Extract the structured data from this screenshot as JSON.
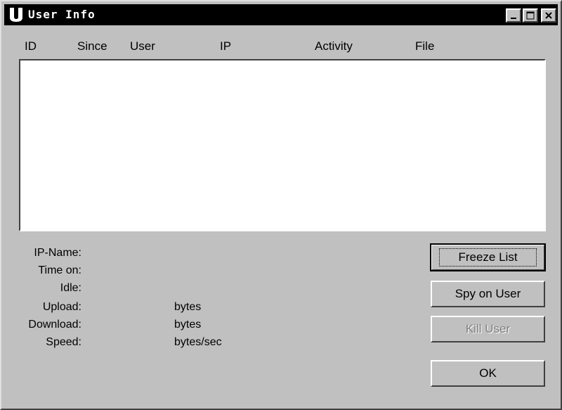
{
  "window": {
    "title": "User Info"
  },
  "columns": [
    "ID",
    "Since",
    "User",
    "IP",
    "Activity",
    "File"
  ],
  "info_labels": [
    "IP-Name:",
    "Time on:",
    "Idle:",
    "Upload:",
    "Download:",
    "Speed:"
  ],
  "units": {
    "upload": "bytes",
    "download": "bytes",
    "speed": "bytes/sec"
  },
  "buttons": {
    "freeze": "Freeze List",
    "spy": "Spy on User",
    "kill": "Kill User",
    "ok": "OK"
  },
  "icons": {
    "app": "u-logo-icon",
    "minimize": "minimize-icon",
    "maximize": "maximize-icon",
    "close": "close-icon"
  }
}
